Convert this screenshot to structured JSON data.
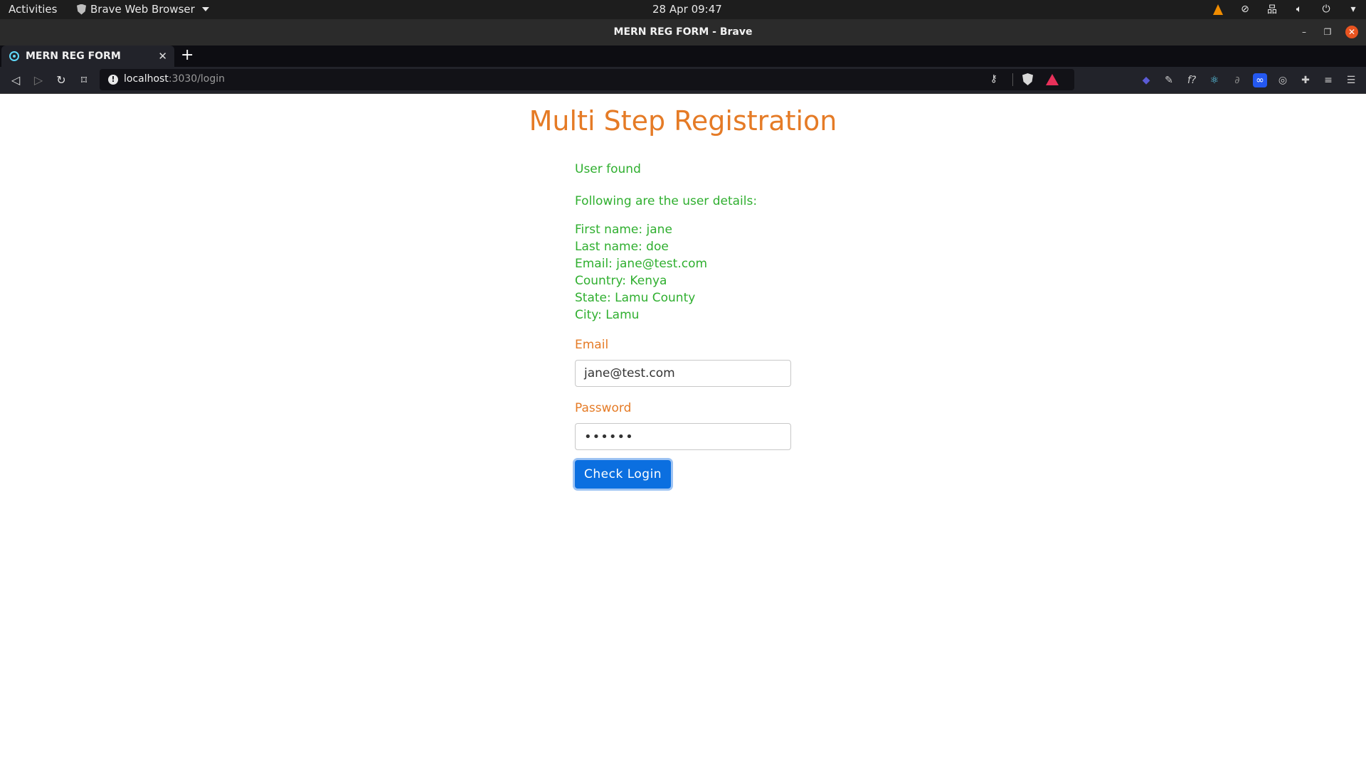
{
  "system_bar": {
    "activities": "Activities",
    "app_menu": "Brave Web Browser",
    "clock": "28 Apr  09:47"
  },
  "window": {
    "title": "MERN REG FORM - Brave"
  },
  "tabs": [
    {
      "label": "MERN REG FORM"
    }
  ],
  "address_bar": {
    "host": "localhost",
    "path": ":3030/login"
  },
  "page": {
    "heading": "Multi Step Registration",
    "status_message": "User found",
    "details_intro": "Following are the user details:",
    "details": [
      "First name: jane",
      "Last name: doe",
      "Email: jane@test.com",
      "Country: Kenya",
      "State: Lamu County",
      "City: Lamu"
    ],
    "email_label": "Email",
    "email_value": "jane@test.com",
    "password_label": "Password",
    "password_value": "••••••",
    "submit_label": "Check Login"
  },
  "colors": {
    "heading": "#e57b26",
    "success_text": "#2faf2f",
    "button": "#0b6fe0"
  },
  "icons": {
    "extensions": [
      "ethereum-wallet-icon",
      "color-picker-icon",
      "function-icon",
      "react-devtools-icon",
      "redux-icon",
      "messenger-icon",
      "target-icon",
      "puzzle-icon",
      "media-icon",
      "menu-icon"
    ]
  }
}
